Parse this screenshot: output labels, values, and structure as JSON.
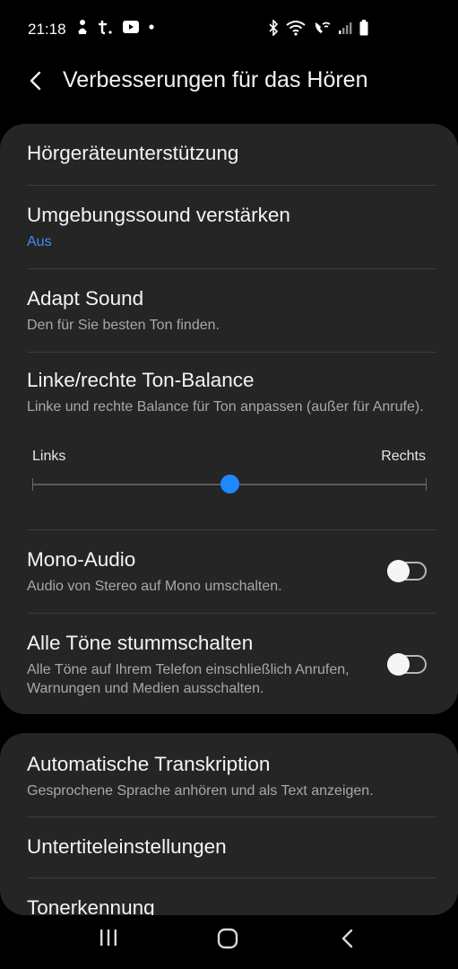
{
  "status_bar": {
    "time": "21:18",
    "left_icons": [
      "silent-icon",
      "t-app-icon",
      "youtube-icon",
      "dot-icon"
    ],
    "right_icons": [
      "bluetooth-icon",
      "wifi-icon",
      "wifi-calling-icon",
      "signal-icon",
      "battery-icon"
    ]
  },
  "header": {
    "title": "Verbesserungen für das Hören"
  },
  "card1": {
    "item1": {
      "title": "Hörgeräteunterstützung"
    },
    "item2": {
      "title": "Umgebungssound verstärken",
      "subtitle": "Aus"
    },
    "item3": {
      "title": "Adapt Sound",
      "subtitle": "Den für Sie besten Ton finden."
    },
    "item4": {
      "title": "Linke/rechte Ton-Balance",
      "subtitle": "Linke und rechte Balance für Ton anpassen (außer für Anrufe).",
      "left_label": "Links",
      "right_label": "Rechts",
      "balance_fraction": 0.5
    },
    "item5": {
      "title": "Mono-Audio",
      "subtitle": "Audio von Stereo auf Mono umschalten.",
      "enabled": false
    },
    "item6": {
      "title": "Alle Töne stummschalten",
      "subtitle": "Alle Töne auf Ihrem Telefon einschließlich Anrufen, Warnungen und Medien ausschalten.",
      "enabled": false
    }
  },
  "card2": {
    "item1": {
      "title": "Automatische Transkription",
      "subtitle": "Gesprochene Sprache anhören und als Text anzeigen."
    },
    "item2": {
      "title": "Untertiteleinstellungen"
    },
    "item3": {
      "title": "Tonerkennung"
    }
  },
  "nav_bar": {
    "buttons": [
      "recent-apps-icon",
      "home-icon",
      "back-icon"
    ]
  },
  "colors": {
    "accent": "#1e88ff",
    "link_blue": "#3d8ef7",
    "card_bg": "#252525",
    "background": "#000000"
  }
}
